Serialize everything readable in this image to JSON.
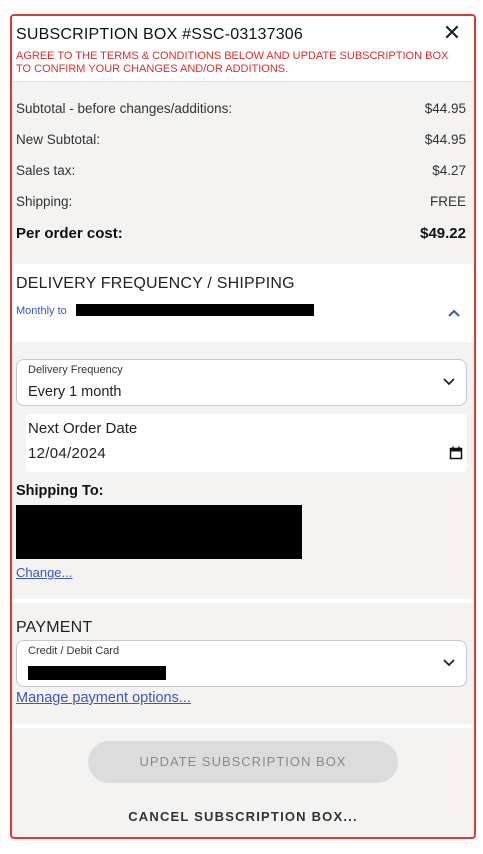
{
  "header": {
    "title": "SUBSCRIPTION BOX #SSC-03137306",
    "notice": "AGREE TO THE TERMS & CONDITIONS BELOW AND UPDATE SUBSCRIPTION BOX TO CONFIRM YOUR CHANGES AND/OR ADDITIONS.",
    "close_icon": "close-icon"
  },
  "summary": {
    "subtotal_before_label": "Subtotal - before changes/additions:",
    "subtotal_before_value": "$44.95",
    "new_subtotal_label": "New Subtotal:",
    "new_subtotal_value": "$44.95",
    "sales_tax_label": "Sales tax:",
    "sales_tax_value": "$4.27",
    "shipping_label": "Shipping:",
    "shipping_value": "FREE",
    "per_order_label": "Per order cost:",
    "per_order_value": "$49.22"
  },
  "delivery": {
    "section_title": "DELIVERY FREQUENCY / SHIPPING",
    "summary_prefix": "Monthly to",
    "frequency_label": "Delivery Frequency",
    "frequency_value": "Every 1 month",
    "next_order_label": "Next Order Date",
    "next_order_value": "12/04/2024",
    "shipping_to_label": "Shipping To:",
    "change_link": "Change..."
  },
  "payment": {
    "section_title": "PAYMENT",
    "method_label": "Credit / Debit Card",
    "manage_link": "Manage payment options..."
  },
  "actions": {
    "update_label": "UPDATE SUBSCRIPTION BOX",
    "cancel_label": "CANCEL SUBSCRIPTION BOX..."
  },
  "colors": {
    "accent_red": "#e03a2f",
    "link_blue": "#3b57b8",
    "disabled_button": "#dcdcdc"
  }
}
